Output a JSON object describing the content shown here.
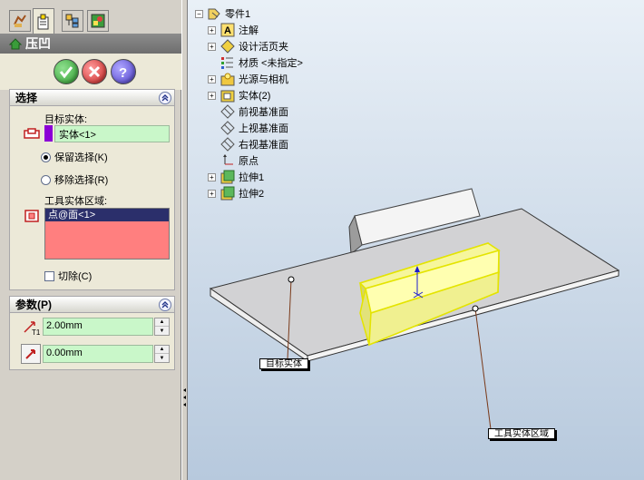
{
  "property_manager": {
    "title": "压凹",
    "tabs": [
      "feature-manager-icon",
      "property-manager-icon",
      "configuration-manager-icon",
      "display-manager-icon"
    ],
    "ok_icon": "check-icon",
    "cancel_icon": "close-icon",
    "help_icon": "help-icon",
    "selection": {
      "header": "选择",
      "target_label": "目标实体:",
      "target_value": "实体<1>",
      "keep_label": "保留选择(K)",
      "remove_label": "移除选择(R)",
      "keep_selected": true,
      "tool_label": "工具实体区域:",
      "tool_items": [
        "点@面<1>"
      ],
      "cut_label": "切除(C)",
      "cut_checked": false
    },
    "parameters": {
      "header": "参数(P)",
      "thickness_value": "2.00mm",
      "clearance_value": "0.00mm"
    }
  },
  "tree": {
    "root": "零件1",
    "items": [
      {
        "label": "注解",
        "icon": "annotation-icon"
      },
      {
        "label": "设计活页夹",
        "icon": "binder-icon"
      },
      {
        "label": "材质 <未指定>",
        "icon": "material-icon"
      },
      {
        "label": "光源与相机",
        "icon": "lights-icon"
      },
      {
        "label": "实体(2)",
        "icon": "solid-bodies-icon"
      },
      {
        "label": "前视基准面",
        "icon": "plane-icon"
      },
      {
        "label": "上视基准面",
        "icon": "plane-icon"
      },
      {
        "label": "右视基准面",
        "icon": "plane-icon"
      },
      {
        "label": "原点",
        "icon": "origin-icon"
      },
      {
        "label": "拉伸1",
        "icon": "extrude-icon"
      },
      {
        "label": "拉伸2",
        "icon": "extrude-icon"
      }
    ]
  },
  "callouts": {
    "target": "目标实体",
    "tool": "工具实体区域"
  },
  "colors": {
    "selection_green": "#c9f7c9",
    "tool_region_pink": "#ff7f7f",
    "highlight_yellow": "#ffff66",
    "target_chip": "#8b00d6"
  }
}
